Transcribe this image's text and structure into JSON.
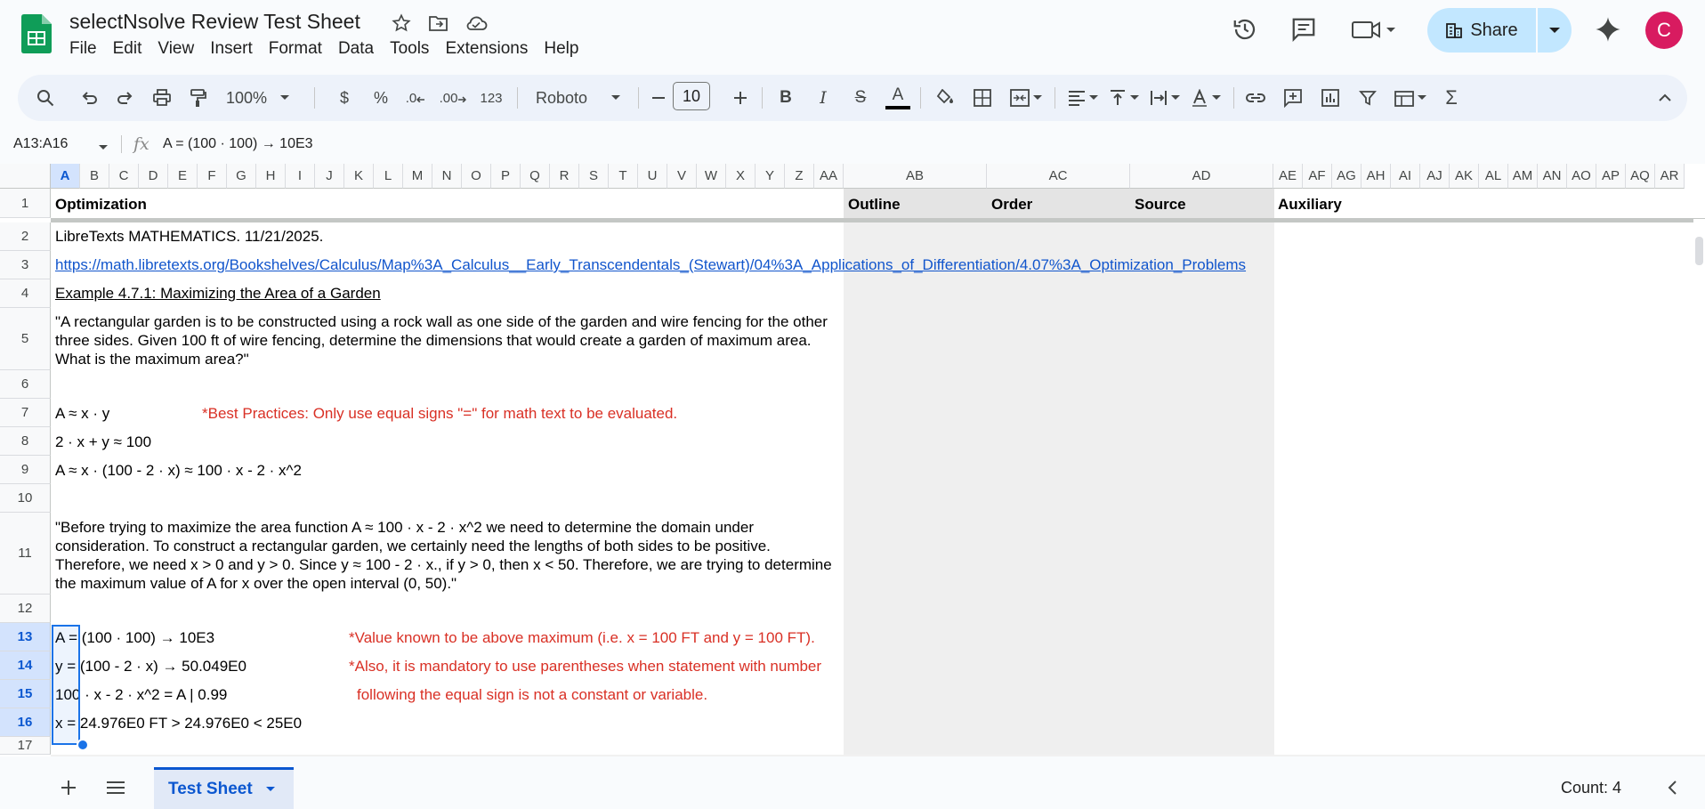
{
  "app": {
    "doc_title": "selectNsolve Review Test Sheet",
    "menu": [
      "File",
      "Edit",
      "View",
      "Insert",
      "Format",
      "Data",
      "Tools",
      "Extensions",
      "Help"
    ],
    "share_label": "Share",
    "avatar_letter": "C",
    "brand_color": "#0f9d58",
    "accent_color": "#0b57d0"
  },
  "toolbar": {
    "zoom": "100%",
    "currency": "$",
    "percent": "%",
    "dec_decrease": ".0",
    "dec_increase": ".00",
    "format_123": "123",
    "font": "Roboto",
    "font_size": "10",
    "bold": "B",
    "italic": "I",
    "strike": "S",
    "text_color": "A",
    "sum": "Σ"
  },
  "formula_bar": {
    "name_box": "A13:A16",
    "fx": "fx",
    "content": "A = (100 · 100) → 10E3"
  },
  "columns": {
    "narrow": [
      "A",
      "B",
      "C",
      "D",
      "E",
      "F",
      "G",
      "H",
      "I",
      "J",
      "K",
      "L",
      "M",
      "N",
      "O",
      "P",
      "Q",
      "R",
      "S",
      "T",
      "U",
      "V",
      "W",
      "X",
      "Y",
      "Z",
      "AA"
    ],
    "wide": [
      "AB",
      "AC",
      "AD"
    ],
    "right": [
      "AE",
      "AF",
      "AG",
      "AH",
      "AI",
      "AJ",
      "AK",
      "AL",
      "AM",
      "AN",
      "AO",
      "AP",
      "AQ",
      "AR"
    ]
  },
  "rows": [
    "1",
    "2",
    "3",
    "4",
    "5",
    "6",
    "7",
    "8",
    "9",
    "10",
    "11",
    "12",
    "13",
    "14",
    "15",
    "16",
    "17"
  ],
  "cells": {
    "r1_a": "Optimization",
    "r1_ab": "Outline",
    "r1_ac": "Order",
    "r1_ad": "Source",
    "r1_ae": "Auxiliary",
    "r2": "LibreTexts MATHEMATICS. 11/21/2025.",
    "r3": "https://math.libretexts.org/Bookshelves/Calculus/Map%3A_Calculus__Early_Transcendentals_(Stewart)/04%3A_Applications_of_Differentiation/4.07%3A_Optimization_Problems",
    "r4": "Example 4.7.1: Maximizing the Area of a Garden",
    "r5": "\"A rectangular garden is to be constructed using a rock wall as one side of the garden and wire fencing for the other three sides. Given 100 ft of wire fencing, determine the dimensions that would create a garden of maximum area. What is the maximum area?\"",
    "r7": "A ≈ x · y",
    "r7_note": "*Best Practices: Only use equal signs \"=\" for math text to be evaluated.",
    "r8": "2 · x + y ≈ 100",
    "r9": "A ≈ x · (100 - 2 · x) ≈ 100 · x - 2 · x^2",
    "r11": "\"Before trying to maximize the area function A ≈ 100 · x - 2 · x^2 we need to determine the domain under consideration. To construct a rectangular garden, we certainly need the lengths of both sides to be positive. Therefore, we need x > 0 and y > 0. Since y ≈ 100 - 2 · x., if y > 0, then x < 50. Therefore, we are trying to determine the maximum value of A for x over the open interval (0, 50).\"",
    "r13": "A = (100 · 100) → 10E3",
    "r13_note": "*Value known to be above maximum (i.e. x = 100 FT and y = 100 FT).",
    "r14": "y = (100 - 2 · x) → 50.049E0",
    "r14_note": "*Also, it is mandatory to use parentheses when statement with number",
    "r15": "100 · x - 2 · x^2 = A | 0.99",
    "r15_note": "following the equal sign is not a constant or variable.",
    "r16": "x = 24.976E0 FT  > 24.976E0 < 25E0"
  },
  "sheet_tab": "Test Sheet",
  "status": "Count: 4"
}
